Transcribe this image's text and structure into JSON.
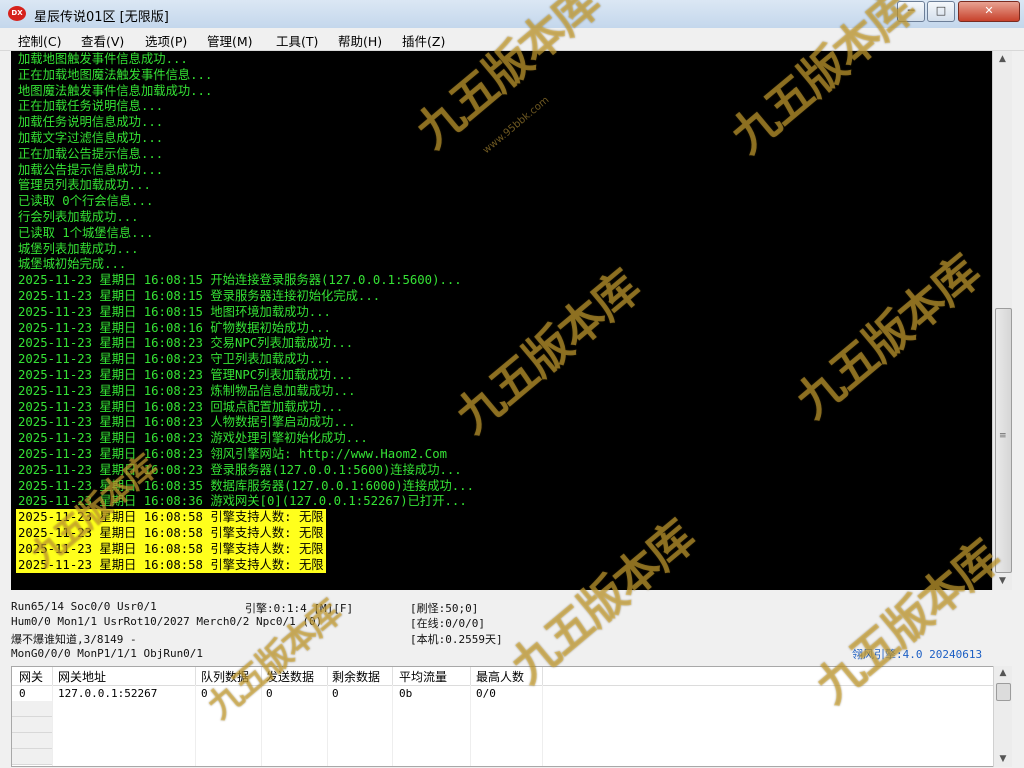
{
  "window": {
    "title": "星辰传说01区 [无限版]",
    "icon_text": "DX",
    "min_glyph": "─",
    "max_glyph": "□",
    "close_glyph": "✕"
  },
  "menu": [
    "控制(C)",
    "查看(V)",
    "选项(P)",
    "管理(M)",
    "工具(T)",
    "帮助(H)",
    "插件(Z)"
  ],
  "console": {
    "lines": [
      "加载地图触发事件信息成功...",
      "正在加载地图魔法触发事件信息...",
      "地图魔法触发事件信息加载成功...",
      "正在加载任务说明信息...",
      "加载任务说明信息成功...",
      "加载文字过滤信息成功...",
      "正在加载公告提示信息...",
      "加载公告提示信息成功...",
      "管理员列表加载成功...",
      "已读取 0个行会信息...",
      "行会列表加载成功...",
      "已读取 1个城堡信息...",
      "城堡列表加载成功...",
      "城堡城初始完成...",
      "2025-11-23 星期日 16:08:15 开始连接登录服务器(127.0.0.1:5600)...",
      "2025-11-23 星期日 16:08:15 登录服务器连接初始化完成...",
      "2025-11-23 星期日 16:08:15 地图环境加载成功...",
      "2025-11-23 星期日 16:08:16 矿物数据初始成功...",
      "2025-11-23 星期日 16:08:23 交易NPC列表加载成功...",
      "2025-11-23 星期日 16:08:23 守卫列表加载成功...",
      "2025-11-23 星期日 16:08:23 管理NPC列表加载成功...",
      "2025-11-23 星期日 16:08:23 炼制物品信息加载成功...",
      "2025-11-23 星期日 16:08:23 回城点配置加载成功...",
      "2025-11-23 星期日 16:08:23 人物数据引擎启动成功...",
      "2025-11-23 星期日 16:08:23 游戏处理引擎初始化成功...",
      "2025-11-23 星期日 16:08:23 翎风引擎网站: http://www.Haom2.Com",
      "2025-11-23 星期日 16:08:23 登录服务器(127.0.0.1:5600)连接成功...",
      "2025-11-23 星期日 16:08:35 数据库服务器(127.0.0.1:6000)连接成功...",
      "2025-11-23 星期日 16:08:36 游戏网关[0](127.0.0.1:52267)已打开..."
    ],
    "highlight_lines": [
      "2025-11-23 星期日 16:08:58 引擎支持人数: 无限",
      "2025-11-23 星期日 16:08:58 引擎支持人数: 无限",
      "2025-11-23 星期日 16:08:58 引擎支持人数: 无限",
      "2025-11-23 星期日 16:08:58 引擎支持人数: 无限"
    ],
    "text_color": "#35e235",
    "highlight_color": "#ffff1c"
  },
  "status": {
    "run": "Run65/14 Soc0/0 Usr0/1",
    "engine": "引擎:0:1:4 [M][F]",
    "refresh": "[刷怪:50;0]",
    "hum": "Hum0/0 Mon1/1 UsrRot10/2027 Merch0/2 Npc0/1 (0)",
    "online": "[在线:0/0/0]",
    "drop": "爆不爆谁知道,3/8149 -",
    "local": "[本机:0.2559天]",
    "mon": "MonG0/0/0 MonP1/1/1 ObjRun0/1",
    "version": "翎风引擎:4.0 20240613"
  },
  "grid": {
    "columns": [
      "网关",
      "网关地址",
      "队列数据",
      "发送数据",
      "剩余数据",
      "平均流量",
      "最高人数"
    ],
    "rows": [
      [
        "0",
        "127.0.0.1:52267",
        "0",
        "0",
        "0",
        "0b",
        "0/0"
      ]
    ]
  },
  "watermark": {
    "text": "九五版本库",
    "url": "www.95bbk.com"
  }
}
